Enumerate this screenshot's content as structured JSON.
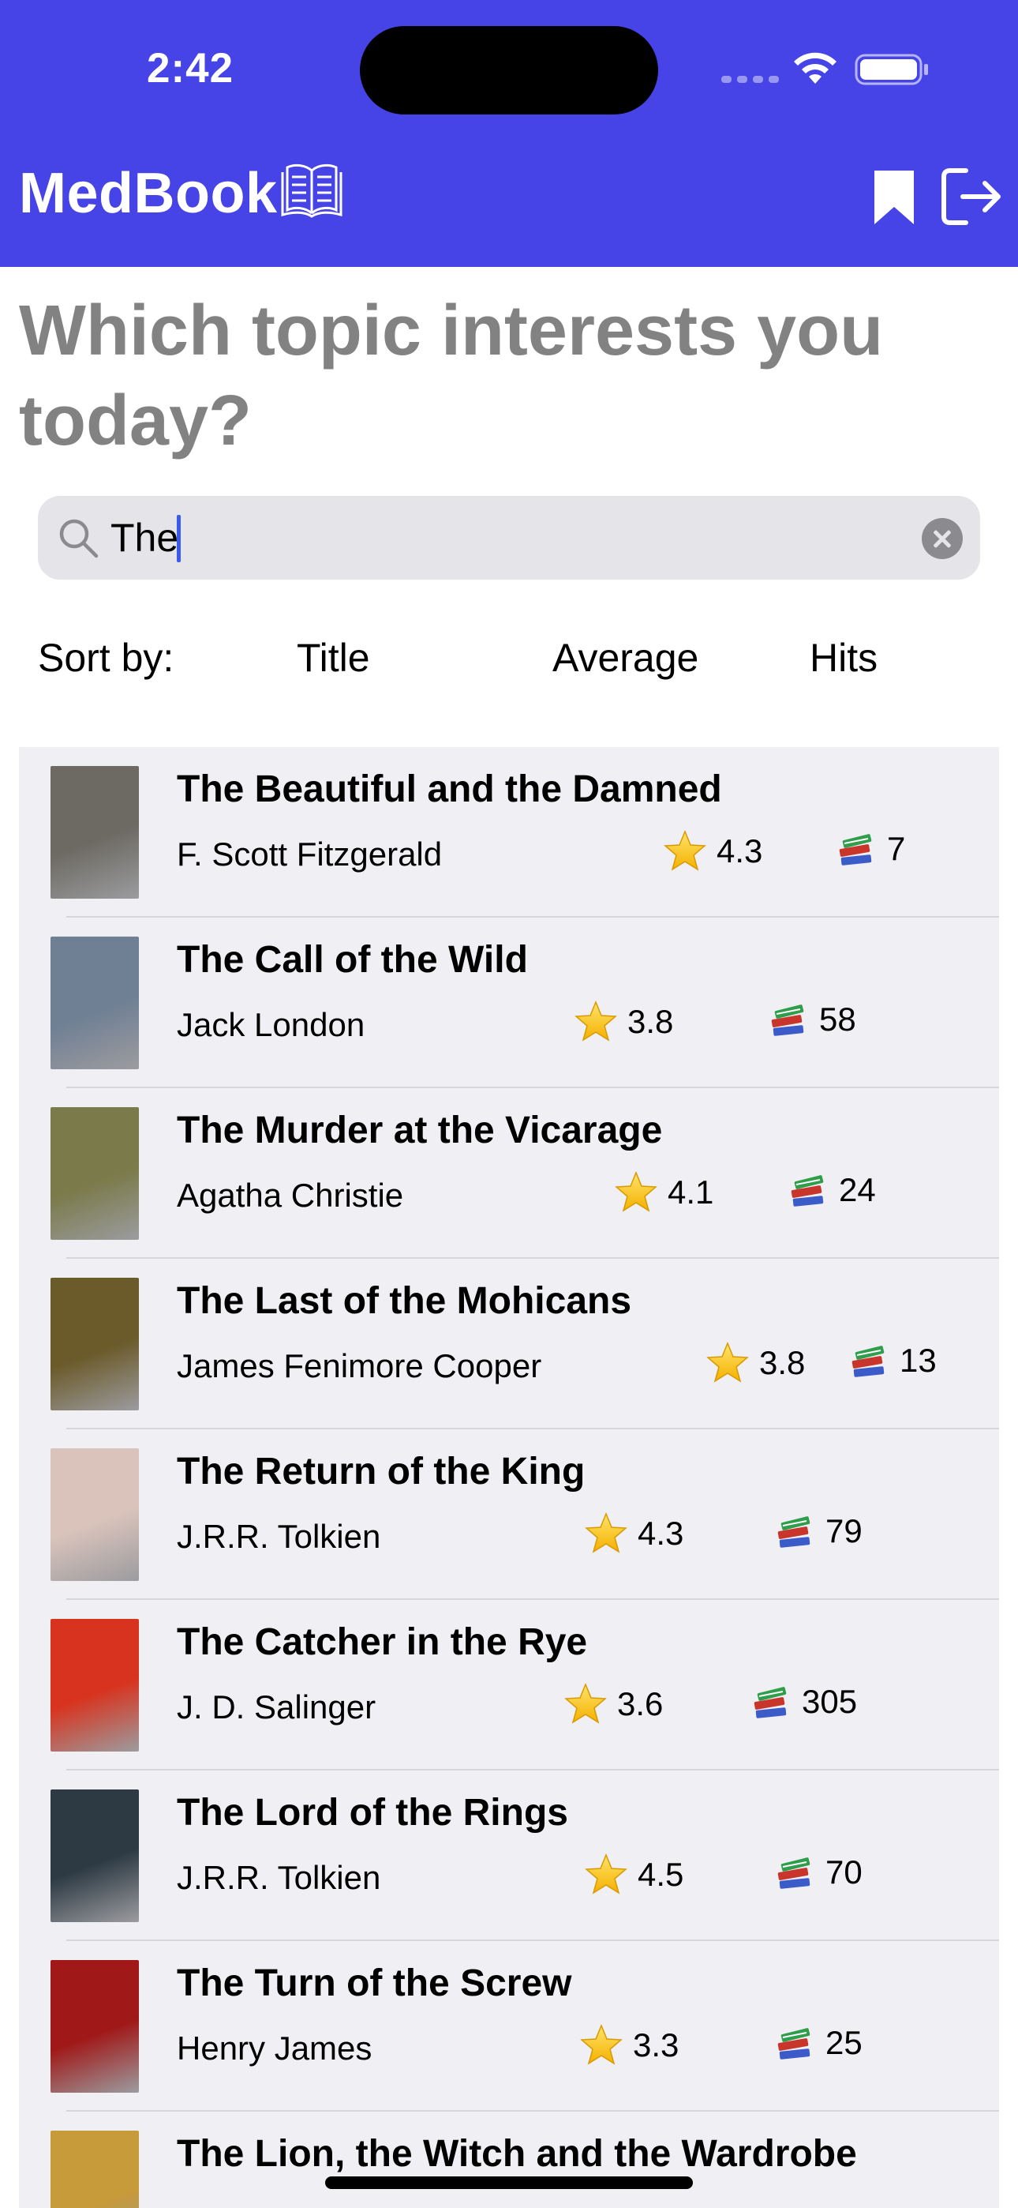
{
  "status_bar": {
    "time": "2:42"
  },
  "header": {
    "app_title": "MedBook"
  },
  "heading": "Which topic interests you today?",
  "search": {
    "value": "The",
    "placeholder": ""
  },
  "sort": {
    "label": "Sort by:",
    "options": [
      "Title",
      "Average",
      "Hits"
    ]
  },
  "books": [
    {
      "title": "The Beautiful and the Damned",
      "author": "F. Scott Fitzgerald",
      "rating": "4.3",
      "hits": "7",
      "cover_color": "#6d6a63"
    },
    {
      "title": "The Call of the Wild",
      "author": "Jack London",
      "rating": "3.8",
      "hits": "58",
      "cover_color": "#6f7f94"
    },
    {
      "title": "The Murder at the Vicarage",
      "author": "Agatha Christie",
      "rating": "4.1",
      "hits": "24",
      "cover_color": "#7a7a4a"
    },
    {
      "title": "The Last of the Mohicans",
      "author": "James Fenimore Cooper",
      "rating": "3.8",
      "hits": "13",
      "cover_color": "#6b5a2a"
    },
    {
      "title": "The Return of the King",
      "author": "J.R.R. Tolkien",
      "rating": "4.3",
      "hits": "79",
      "cover_color": "#d9c3bb"
    },
    {
      "title": "The Catcher in the Rye",
      "author": "J. D. Salinger",
      "rating": "3.6",
      "hits": "305",
      "cover_color": "#d8331e"
    },
    {
      "title": "The Lord of the Rings",
      "author": "J.R.R. Tolkien",
      "rating": "4.5",
      "hits": "70",
      "cover_color": "#2d3a44"
    },
    {
      "title": "The Turn of the Screw",
      "author": "Henry James",
      "rating": "3.3",
      "hits": "25",
      "cover_color": "#a01818"
    },
    {
      "title": "The Lion, the Witch and the Wardrobe",
      "author": "",
      "rating": "",
      "hits": "",
      "cover_color": "#c79a3a"
    }
  ],
  "colors": {
    "accent": "#4644E6",
    "list_bg": "#EFEFF4"
  }
}
